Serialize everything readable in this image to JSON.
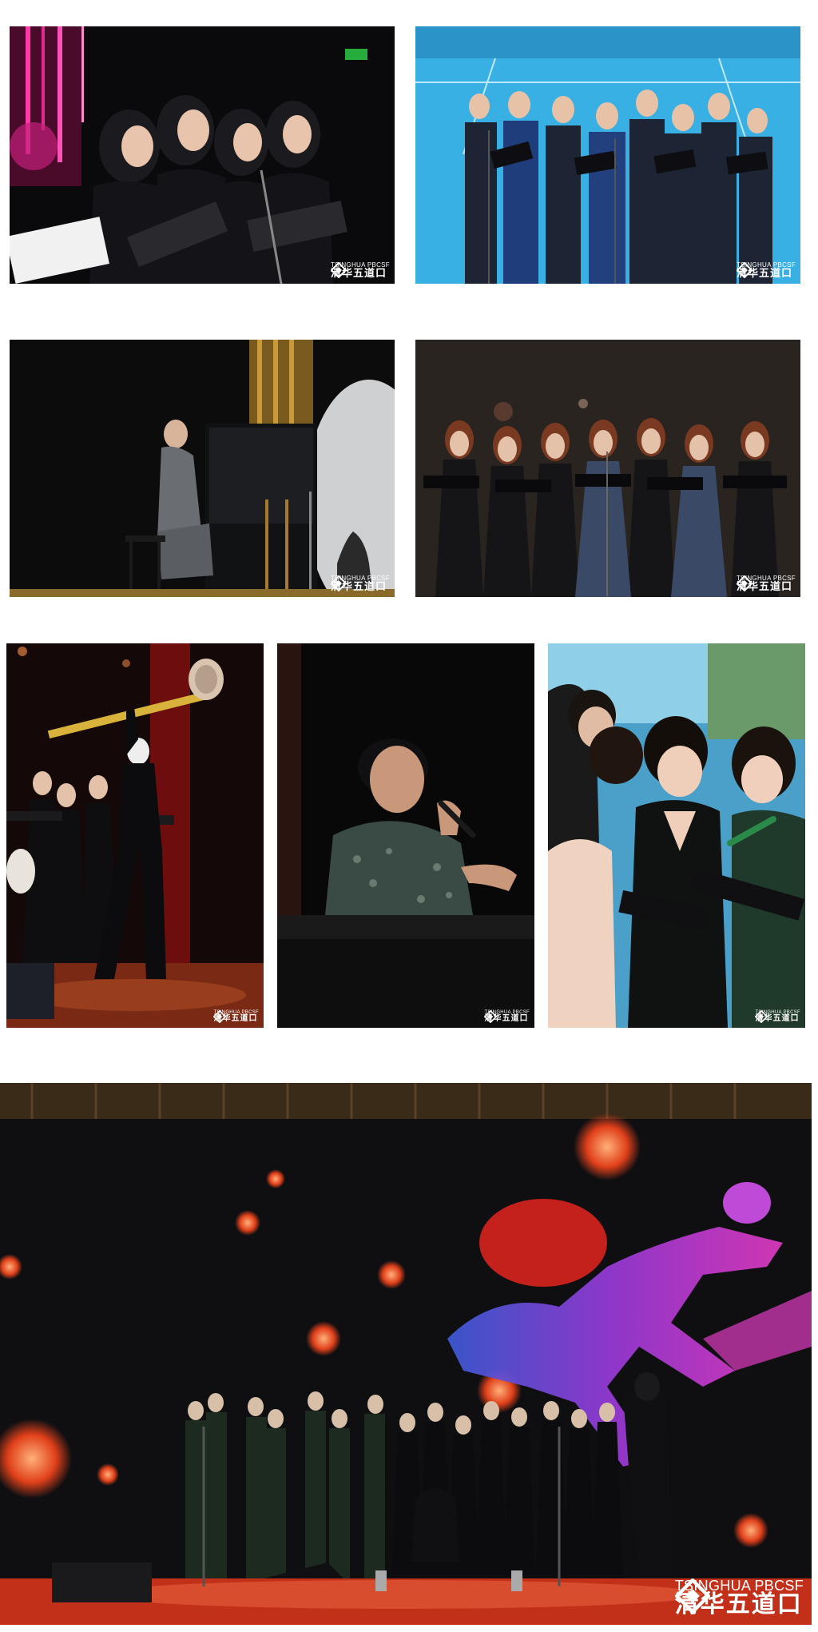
{
  "gallery": {
    "photos": [
      {
        "id": "a",
        "subject": "women-singing-with-score-books"
      },
      {
        "id": "b",
        "subject": "men-in-suits-choir-outdoor-court"
      },
      {
        "id": "c",
        "subject": "pianist-at-upright-piano"
      },
      {
        "id": "d",
        "subject": "women-choir-in-dark-gowns"
      },
      {
        "id": "e",
        "subject": "performer-raising-hammer-prop"
      },
      {
        "id": "f",
        "subject": "male-singer-with-microphone"
      },
      {
        "id": "g",
        "subject": "women-singers-closeup"
      },
      {
        "id": "h",
        "subject": "full-choir-on-stage-with-runner-backdrop"
      }
    ]
  },
  "watermark": {
    "english": "TSINGHUA PBCSF",
    "chinese": "清华五道口",
    "icon": "tsinghua-pbcsf-logo-icon",
    "color": "#ffffff"
  },
  "palette": {
    "stage_red": "#b8321c",
    "court_blue": "#3fb6ea",
    "backdrop_magenta": "#d636c8",
    "backdrop_blue": "#3d5bd9",
    "stage_dark": "#0c0c10"
  }
}
